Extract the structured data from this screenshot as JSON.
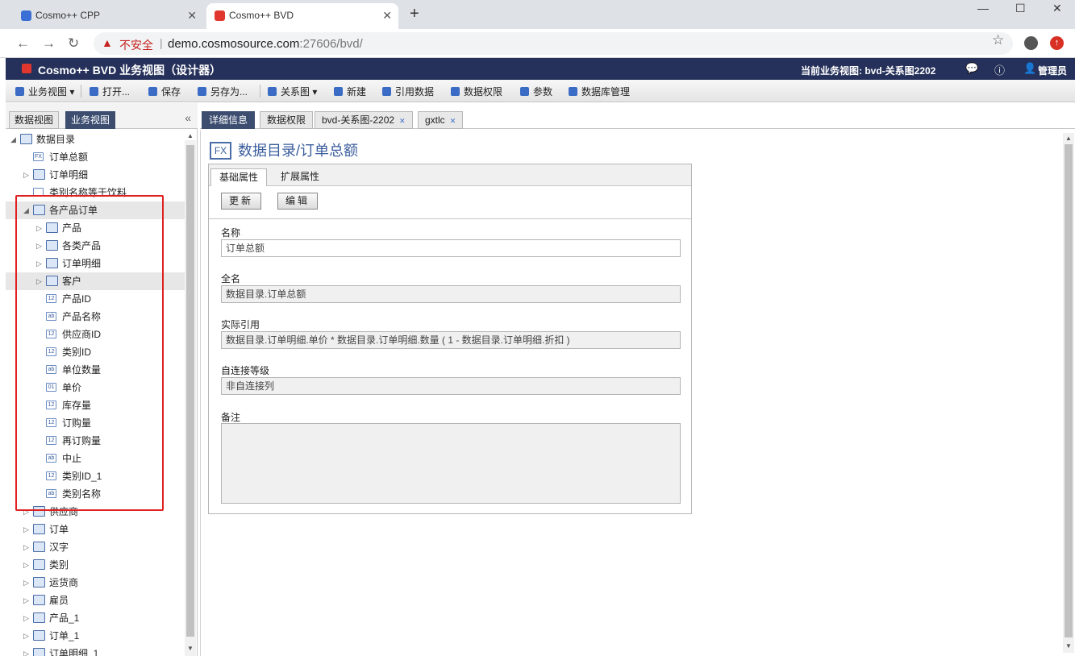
{
  "browser": {
    "tabs": [
      {
        "label": "Cosmo++ CPP"
      },
      {
        "label": "Cosmo++ BVD"
      }
    ],
    "new_tab": "+",
    "controls": {
      "minimize": "—",
      "maximize": "☐",
      "close": "✕"
    },
    "security_label": "不安全",
    "url_host": "demo.cosmosource.com",
    "url_path": ":27606/bvd/"
  },
  "app": {
    "title": "Cosmo++ BVD 业务视图（设计器）",
    "current_view": "当前业务视图: bvd-关系图2202",
    "user": "管理员"
  },
  "toolbar": [
    {
      "label": "业务视图 ▾"
    },
    {
      "label": "打开..."
    },
    {
      "label": "保存"
    },
    {
      "label": "另存为..."
    },
    {
      "label": "关系图 ▾"
    },
    {
      "label": "新建"
    },
    {
      "label": "引用数据"
    },
    {
      "label": "数据权限"
    },
    {
      "label": "参数"
    },
    {
      "label": "数据库管理"
    }
  ],
  "left_tabs": [
    {
      "label": "数据视图"
    },
    {
      "label": "业务视图"
    }
  ],
  "tree": [
    {
      "label": "数据目录",
      "arrow": "◢"
    },
    {
      "label": "订单总额",
      "arrow": "",
      "icon": "FX"
    },
    {
      "label": "订单明细",
      "arrow": "▷"
    },
    {
      "label": "类别名称等于饮料",
      "arrow": "",
      "icon": "filter"
    },
    {
      "label": "各产品订单",
      "arrow": "◢"
    },
    {
      "label": "产品",
      "arrow": "▷"
    },
    {
      "label": "各类产品",
      "arrow": "▷"
    },
    {
      "label": "订单明细",
      "arrow": "▷"
    },
    {
      "label": "客户",
      "arrow": "▷"
    },
    {
      "label": "产品ID",
      "icon": "12"
    },
    {
      "label": "产品名称",
      "icon": "ab"
    },
    {
      "label": "供应商ID",
      "icon": "12"
    },
    {
      "label": "类别ID",
      "icon": "12"
    },
    {
      "label": "单位数量",
      "icon": "ab"
    },
    {
      "label": "单价",
      "icon": "01"
    },
    {
      "label": "库存量",
      "icon": "12"
    },
    {
      "label": "订购量",
      "icon": "12"
    },
    {
      "label": "再订购量",
      "icon": "12"
    },
    {
      "label": "中止",
      "icon": "ab"
    },
    {
      "label": "类别ID_1",
      "icon": "12"
    },
    {
      "label": "类别名称",
      "icon": "ab"
    },
    {
      "label": "供应商",
      "arrow": "▷"
    },
    {
      "label": "订单",
      "arrow": "▷"
    },
    {
      "label": "汉字",
      "arrow": "▷"
    },
    {
      "label": "类别",
      "arrow": "▷"
    },
    {
      "label": "运货商",
      "arrow": "▷"
    },
    {
      "label": "雇员",
      "arrow": "▷"
    },
    {
      "label": "产品_1",
      "arrow": "▷"
    },
    {
      "label": "订单_1",
      "arrow": "▷"
    },
    {
      "label": "订单明细_1",
      "arrow": "▷"
    }
  ],
  "right_tabs": [
    {
      "label": "详细信息"
    },
    {
      "label": "数据权限"
    },
    {
      "label": "bvd-关系图-2202"
    },
    {
      "label": "gxtlc"
    }
  ],
  "detail": {
    "icon_text": "FX",
    "title": "数据目录/订单总额",
    "prop_tabs": [
      {
        "label": "基础属性"
      },
      {
        "label": "扩展属性"
      }
    ],
    "update_button": "更新",
    "edit_button": "编辑",
    "fields": {
      "name_label": "名称",
      "name_value": "订单总额",
      "fullname_label": "全名",
      "fullname_value": "数据目录.订单总额",
      "ref_label": "实际引用",
      "ref_value": "数据目录.订单明细.单价 * 数据目录.订单明细.数量 ( 1 - 数据目录.订单明细.折扣 )",
      "selfjoin_label": "自连接等级",
      "selfjoin_value": "非自连接列",
      "note_label": "备注",
      "note_value": ""
    }
  },
  "colors": {
    "header": "#25315a",
    "active_tab": "#3c4d70",
    "accent_blue": "#3a5d9c",
    "highlight_red": "#e02020"
  }
}
